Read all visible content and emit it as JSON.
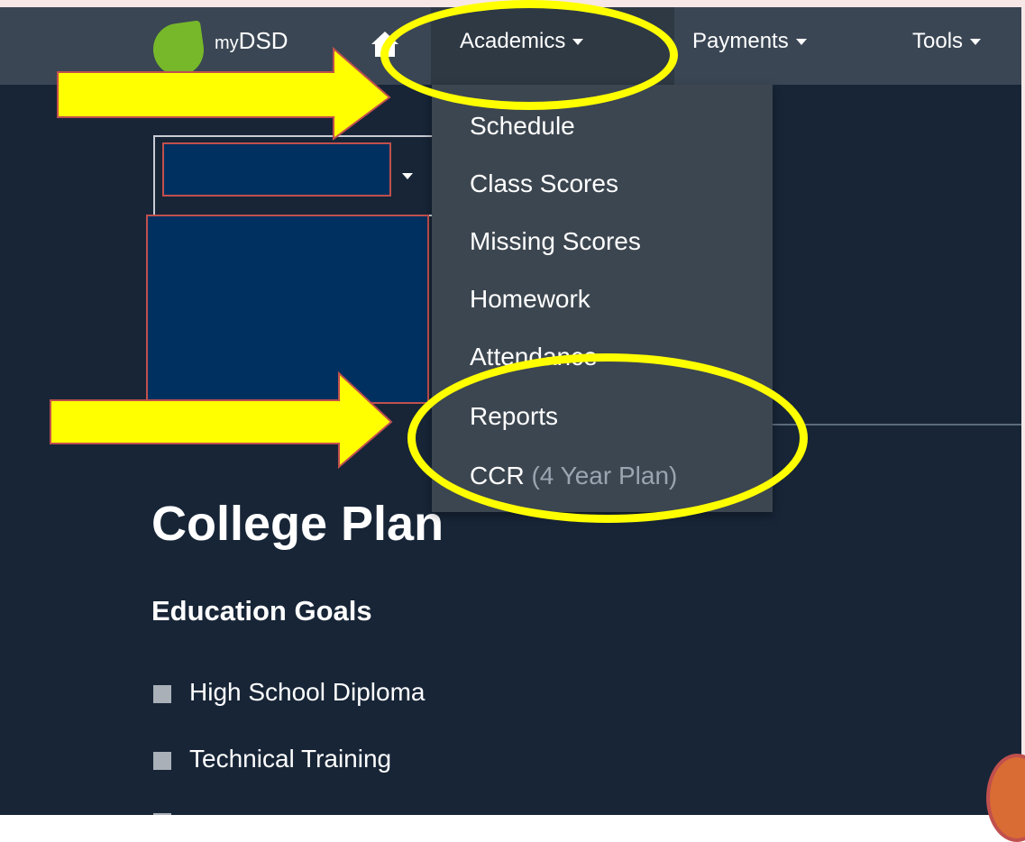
{
  "nav": {
    "brand_prefix": "my",
    "brand_name": "DSD",
    "items": [
      {
        "label": "Academics"
      },
      {
        "label": "Payments"
      },
      {
        "label": "Tools"
      }
    ]
  },
  "dropdown": {
    "items": [
      {
        "label": "Schedule"
      },
      {
        "label": "Class Scores"
      },
      {
        "label": "Missing Scores"
      },
      {
        "label": "Homework"
      },
      {
        "label": "Attendance"
      },
      {
        "label": "Reports"
      }
    ],
    "ccr_label": "CCR",
    "ccr_sub": "(4 Year Plan)"
  },
  "content": {
    "title": "College Plan",
    "section": "Education Goals",
    "goals": [
      "High School Diploma",
      "Technical Training"
    ]
  },
  "colors": {
    "navbar": "#3a4654",
    "background": "#172537",
    "highlight": "#ffff00",
    "brand_leaf": "#76b82a"
  }
}
